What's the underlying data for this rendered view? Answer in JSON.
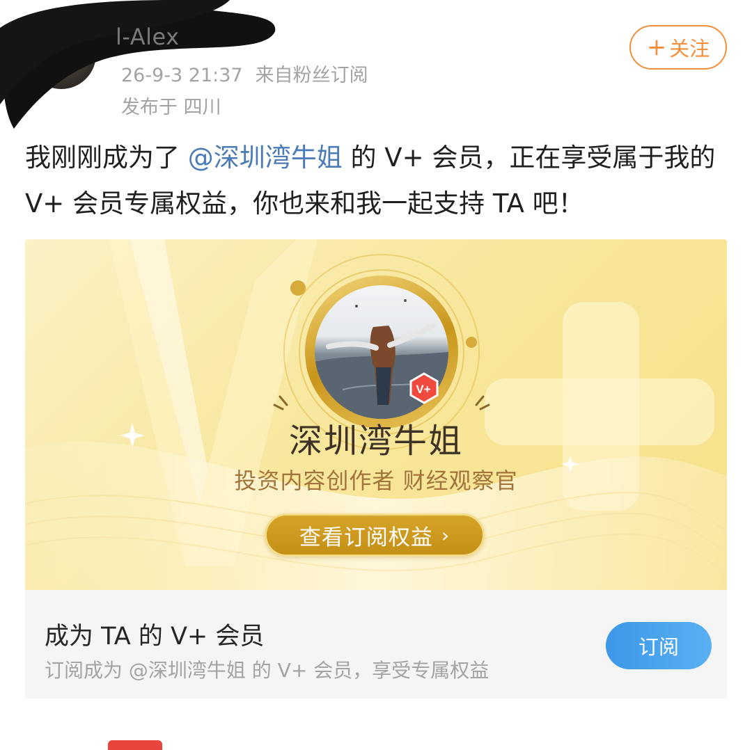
{
  "post": {
    "user_name": "l-Alex",
    "timestamp": "26-9-3 21:37",
    "source": "来自粉丝订阅",
    "location": "发布于 四川",
    "follow_label": "关注",
    "text_part1": "我刚刚成为了",
    "mention": "@深圳湾牛姐",
    "text_part2": "的 V+ 会员，正在享受属于我的 V+ 会员专属权益，你也来和我一起支持 TA 吧！"
  },
  "card": {
    "creator_name": "深圳湾牛姐",
    "creator_tag": "投资内容创作者 财经观察官",
    "view_button": "查看订阅权益",
    "chevron": "›",
    "footer_title": "成为 TA 的 V+ 会员",
    "footer_desc": "订阅成为 @深圳湾牛姐 的 V+ 会员，享受专属权益",
    "subscribe_label": "订阅",
    "badge_text": "V+"
  },
  "icons": {
    "follow": "plus-icon",
    "chevron": "chevron-right-icon",
    "badge": "vplus-badge-icon"
  },
  "colors": {
    "accent_orange": "#f28f3b",
    "mention_blue": "#4a7bb8",
    "gold": "#c48f15",
    "subscribe_blue": "#3d97e9"
  }
}
